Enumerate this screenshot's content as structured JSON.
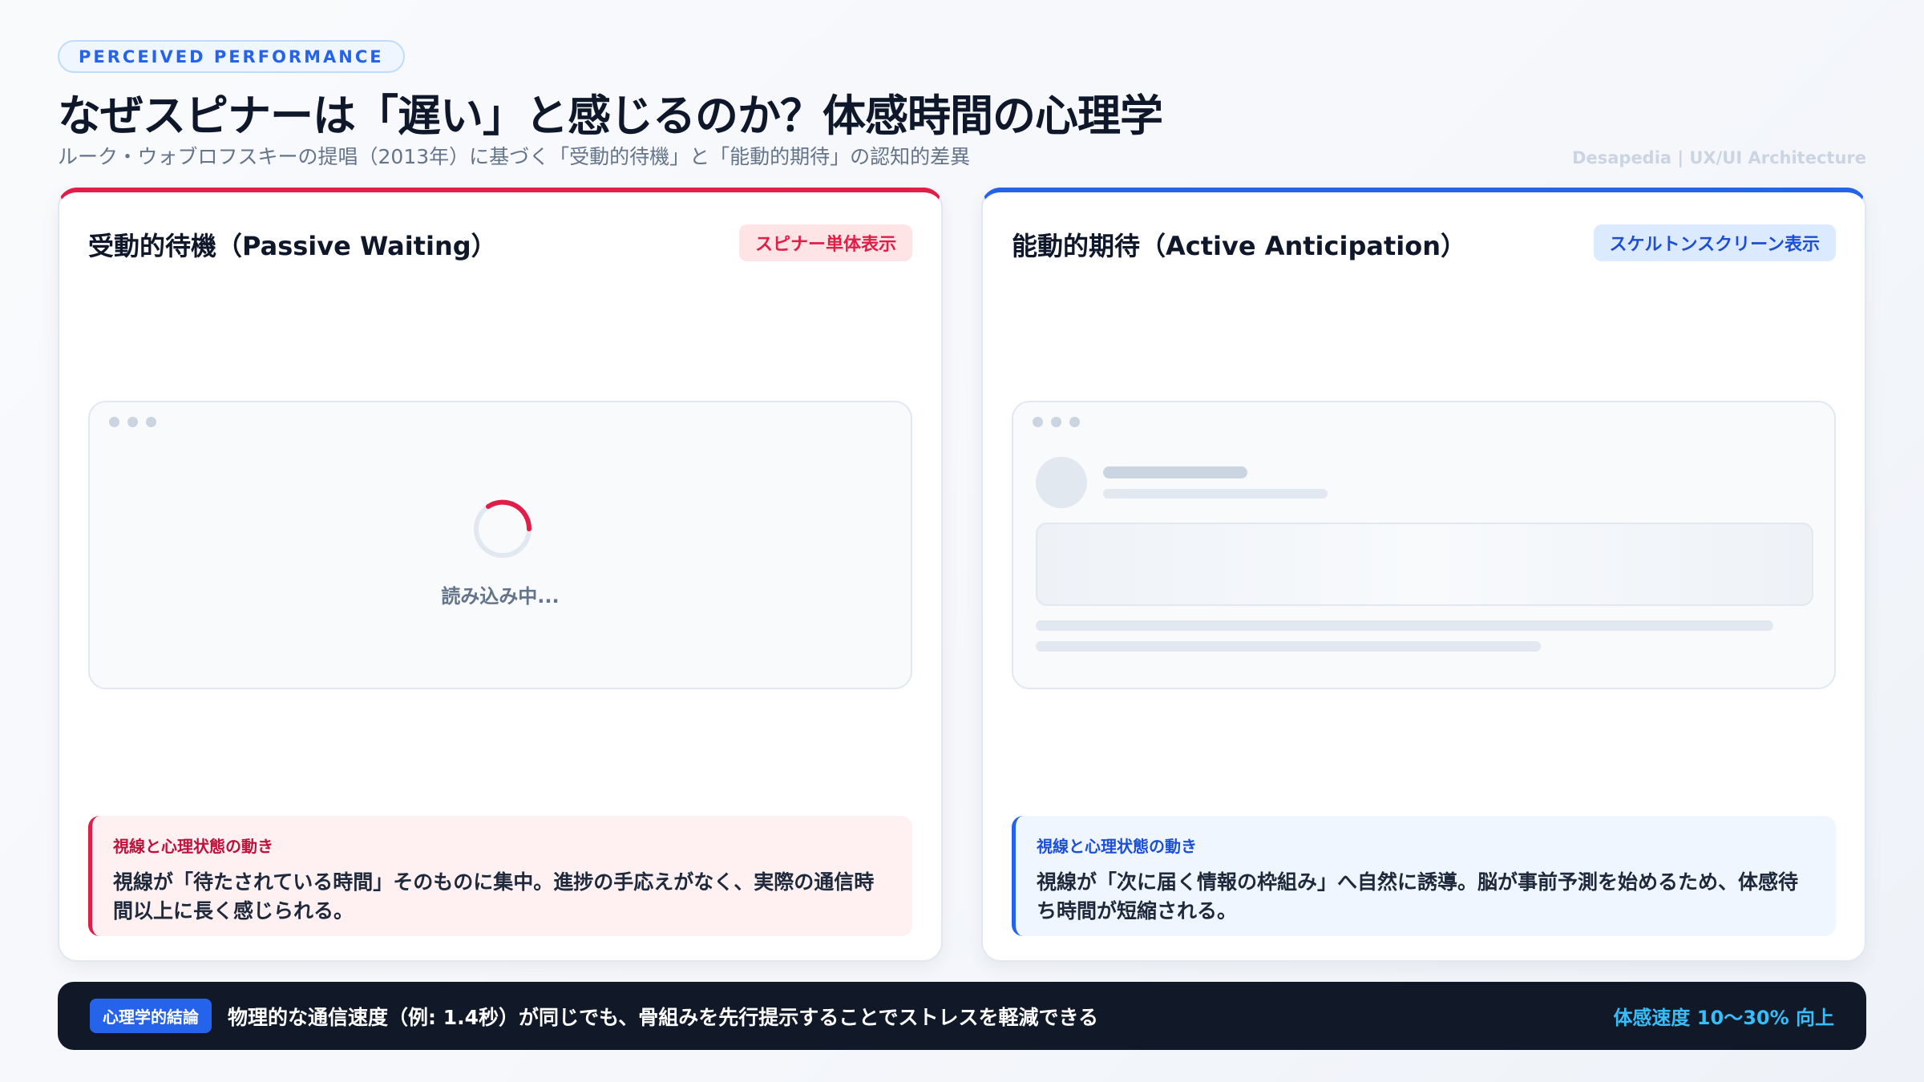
{
  "header": {
    "tag": "PERCEIVED PERFORMANCE",
    "title": "なぜスピナーは「遅い」と感じるのか？体感時間の心理学",
    "subtitle": "ルーク・ウォブロフスキーの提唱（2013年）に基づく「受動的待機」と「能動的期待」の認知的差異",
    "credit": "Desapedia | UX/UI Architecture"
  },
  "passive": {
    "title": "受動的待機（Passive Waiting）",
    "badge": "スピナー単体表示",
    "loading_text": "読み込み中...",
    "note_label": "視線と心理状態の動き",
    "note_body": "視線が「待たされている時間」そのものに集中。進捗の手応えがなく、実際の通信時間以上に長く感じられる。",
    "accent_color": "#e11d48",
    "icons": [
      "window-dots-icon",
      "spinner-icon"
    ]
  },
  "active": {
    "title": "能動的期待（Active Anticipation）",
    "badge": "スケルトンスクリーン表示",
    "note_label": "視線と心理状態の動き",
    "note_body": "視線が「次に届く情報の枠組み」へ自然に誘導。脳が事前予測を始めるため、体感待ち時間が短縮される。",
    "accent_color": "#2563eb",
    "icons": [
      "window-dots-icon",
      "skeleton-avatar-icon"
    ]
  },
  "footer": {
    "badge": "心理学的結論",
    "text": "物理的な通信速度（例: 1.4秒）が同じでも、骨組みを先行提示することでストレスを軽減できる",
    "metric": "体感速度 10〜30% 向上"
  }
}
